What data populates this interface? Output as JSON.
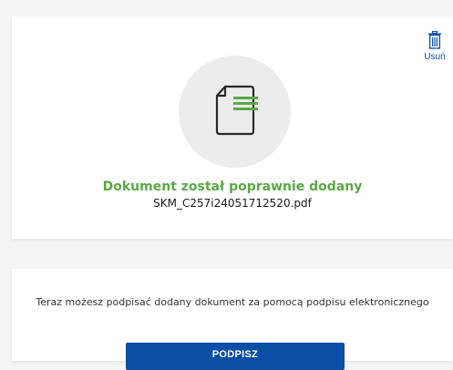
{
  "upload_card": {
    "delete_label": "Usuń",
    "delete_icon": "trash-icon",
    "document_icon": "document-icon",
    "status_title": "Dokument został poprawnie dodany",
    "file_name": "SKM_C257i24051712520.pdf"
  },
  "sign_card": {
    "description": "Teraz możesz podpisać dodany dokument za pomocą podpisu elektronicznego",
    "sign_button_label": "PODPISZ"
  },
  "colors": {
    "accent_blue": "#0a4ea6",
    "success_green": "#5aa845",
    "page_background": "#f4f4f4"
  }
}
